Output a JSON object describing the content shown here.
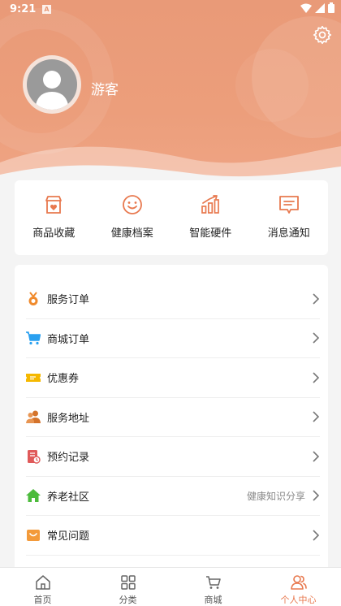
{
  "status_bar": {
    "time": "9:21",
    "notif_letter": "A"
  },
  "profile": {
    "username": "游客"
  },
  "quick_actions": [
    {
      "label": "商品收藏",
      "icon": "shop-heart-icon"
    },
    {
      "label": "健康档案",
      "icon": "smile-icon"
    },
    {
      "label": "智能硬件",
      "icon": "bar-chart-icon"
    },
    {
      "label": "消息通知",
      "icon": "message-icon"
    }
  ],
  "menu": [
    {
      "label": "服务订单",
      "icon": "medal-icon",
      "extra": ""
    },
    {
      "label": "商城订单",
      "icon": "cart-icon",
      "extra": ""
    },
    {
      "label": "优惠券",
      "icon": "coupon-icon",
      "extra": ""
    },
    {
      "label": "服务地址",
      "icon": "users-icon",
      "extra": ""
    },
    {
      "label": "预约记录",
      "icon": "record-icon",
      "extra": ""
    },
    {
      "label": "养老社区",
      "icon": "home-icon",
      "extra": "健康知识分享"
    },
    {
      "label": "常见问题",
      "icon": "faq-icon",
      "extra": ""
    }
  ],
  "tabs": [
    {
      "label": "首页",
      "active": false
    },
    {
      "label": "分类",
      "active": false
    },
    {
      "label": "商城",
      "active": false
    },
    {
      "label": "个人中心",
      "active": true
    }
  ],
  "colors": {
    "accent": "#e8794f",
    "header": "#ec9e7b",
    "coupon": "#f5b800",
    "cart": "#2aa0f0",
    "community": "#4cbb3c",
    "record": "#e05a5a"
  }
}
